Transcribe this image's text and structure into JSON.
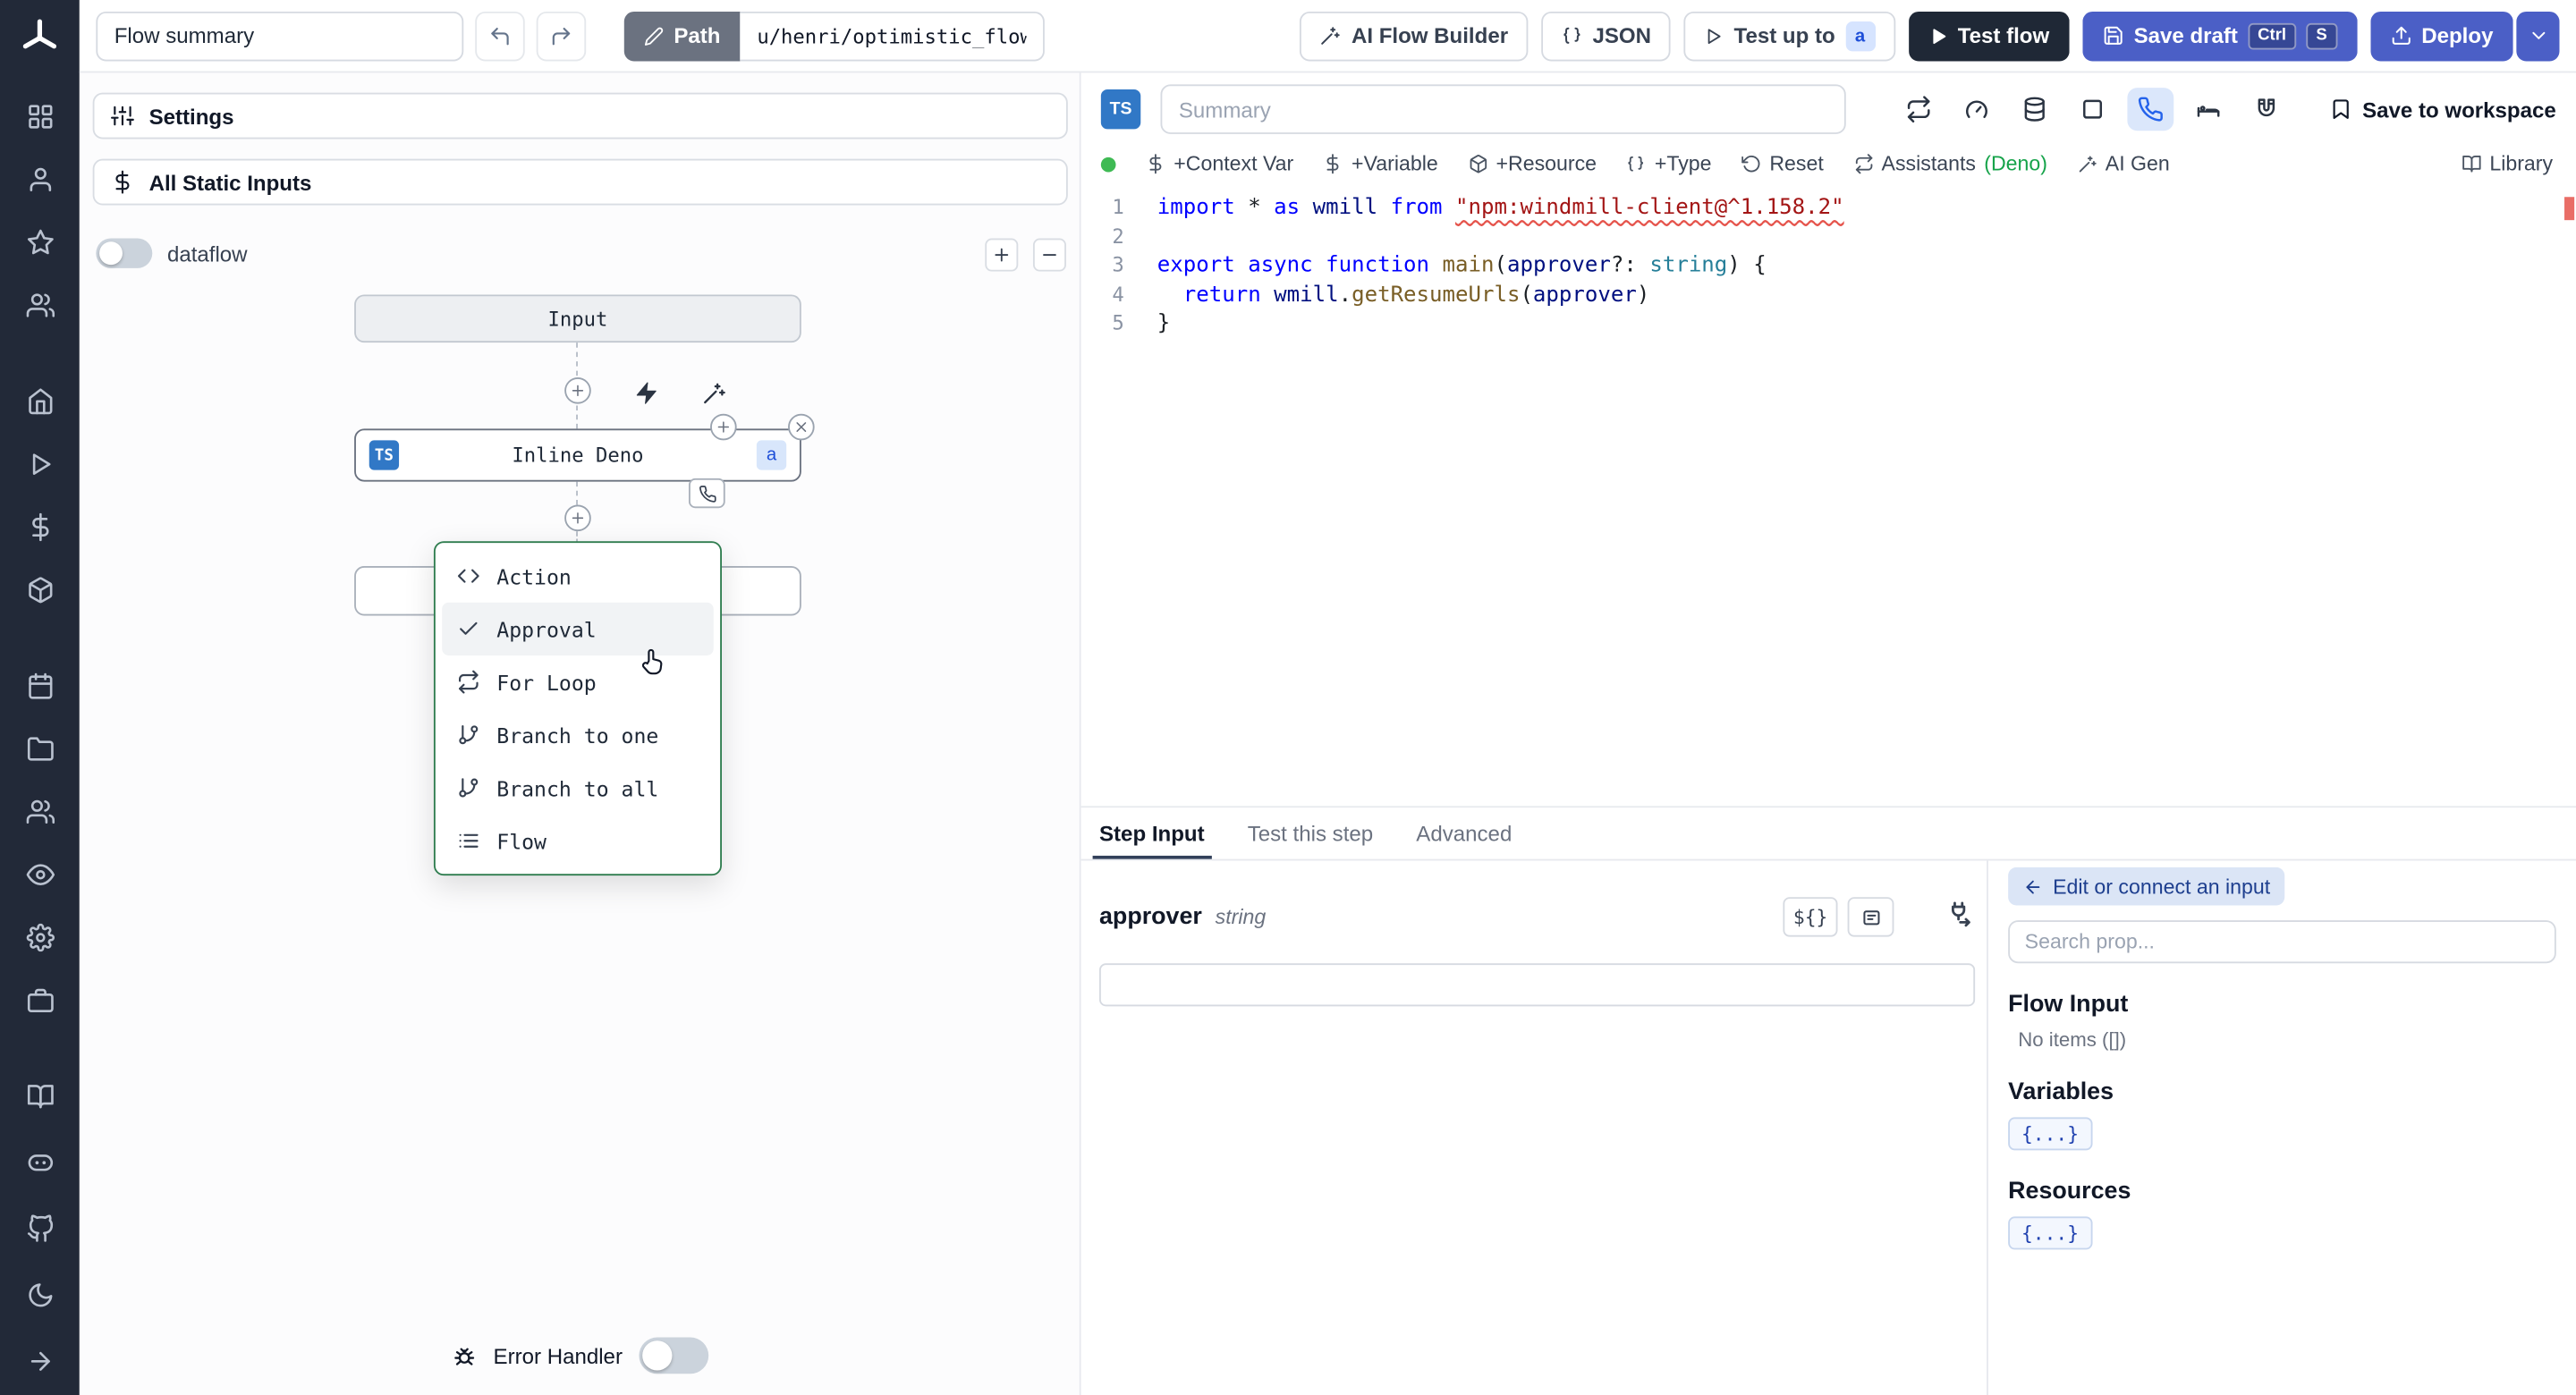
{
  "colors": {
    "accent": "#4b5fc6",
    "sidebar_bg": "#222938",
    "ts_badge": "#3178c6",
    "menu_border": "#2f7d4f",
    "deno_green": "#16a34a",
    "error_red": "#e5534b"
  },
  "sidebar": {
    "groups": [
      [
        "grid",
        "user",
        "star",
        "users"
      ],
      [
        "home",
        "play",
        "dollar-sign",
        "box"
      ],
      [
        "calendar",
        "folder",
        "users",
        "eye",
        "settings",
        "briefcase"
      ]
    ],
    "bottom": [
      "book",
      "discord",
      "github",
      "moon",
      "arrow-right"
    ]
  },
  "topbar": {
    "flow_summary": "Flow summary",
    "path_label": "Path",
    "path_value": "u/henri/optimistic_flow",
    "ai_flow_builder": "AI Flow Builder",
    "json_label": "JSON",
    "test_up_to": "Test up to",
    "test_up_to_badge": "a",
    "test_flow": "Test flow",
    "save_draft": "Save draft",
    "kbd_ctrl": "Ctrl",
    "kbd_s": "S",
    "deploy": "Deploy"
  },
  "flow_panel": {
    "settings": "Settings",
    "all_static_inputs": "All Static Inputs",
    "dataflow_label": "dataflow",
    "input_node": "Input",
    "step_node": {
      "lang_badge": "TS",
      "label": "Inline Deno",
      "suffix_badge": "a"
    },
    "insert_menu": {
      "items": [
        {
          "icon": "code",
          "label": "Action"
        },
        {
          "icon": "check",
          "label": "Approval"
        },
        {
          "icon": "repeat",
          "label": "For Loop"
        },
        {
          "icon": "git-branch",
          "label": "Branch to one"
        },
        {
          "icon": "git-branch",
          "label": "Branch to all"
        },
        {
          "icon": "list",
          "label": "Flow"
        }
      ]
    },
    "error_handler": "Error Handler"
  },
  "editor": {
    "lang_badge": "TS",
    "summary_placeholder": "Summary",
    "save_to_workspace": "Save to workspace",
    "header_icons": [
      {
        "icon": "repeat"
      },
      {
        "icon": "gauge"
      },
      {
        "icon": "database"
      },
      {
        "icon": "square"
      },
      {
        "icon": "phone",
        "active": true
      },
      {
        "icon": "bed"
      },
      {
        "icon": "magnet"
      }
    ],
    "toolbar": {
      "context_var": "+Context Var",
      "variable": "+Variable",
      "resource": "+Resource",
      "type": "+Type",
      "reset": "Reset",
      "assistants": "Assistants",
      "assistants_suffix": "(Deno)",
      "ai_gen": "AI Gen",
      "library": "Library"
    },
    "code": {
      "line_numbers": [
        1,
        2,
        3,
        4,
        5
      ],
      "lines": [
        [
          [
            "kw",
            "import"
          ],
          [
            "pl",
            " * "
          ],
          [
            "kw",
            "as"
          ],
          [
            "pl",
            " "
          ],
          [
            "vr",
            "wmill"
          ],
          [
            "pl",
            " "
          ],
          [
            "kw",
            "from"
          ],
          [
            "pl",
            " "
          ],
          [
            "se",
            "\"npm:windmill-client@^1.158.2\""
          ]
        ],
        [],
        [
          [
            "kw",
            "export"
          ],
          [
            "pl",
            " "
          ],
          [
            "kw",
            "async"
          ],
          [
            "pl",
            " "
          ],
          [
            "kw",
            "function"
          ],
          [
            "pl",
            " "
          ],
          [
            "fn",
            "main"
          ],
          [
            "pl",
            "("
          ],
          [
            "vr",
            "approver"
          ],
          [
            "pl",
            "?: "
          ],
          [
            "ty",
            "string"
          ],
          [
            "pl",
            ") {"
          ]
        ],
        [
          [
            "pl",
            "  "
          ],
          [
            "kw",
            "return"
          ],
          [
            "pl",
            " "
          ],
          [
            "vr",
            "wmill"
          ],
          [
            "pl",
            "."
          ],
          [
            "fn",
            "getResumeUrls"
          ],
          [
            "pl",
            "("
          ],
          [
            "vr",
            "approver"
          ],
          [
            "pl",
            ")"
          ]
        ],
        [
          [
            "pl",
            "}"
          ]
        ]
      ]
    }
  },
  "step_panel": {
    "tabs": [
      "Step Input",
      "Test this step",
      "Advanced"
    ],
    "field": {
      "name": "approver",
      "type": "string",
      "expr_button": "${}"
    },
    "props": {
      "edit_connect": "Edit or connect an input",
      "search_placeholder": "Search prop...",
      "flow_input": "Flow Input",
      "no_items": "No items ([])",
      "variables": "Variables",
      "variables_badge": "{...}",
      "resources": "Resources",
      "resources_badge": "{...}"
    }
  }
}
